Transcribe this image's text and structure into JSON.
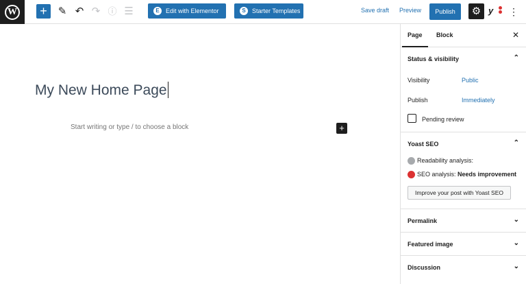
{
  "toolbar": {
    "logo_letter": "W",
    "add_label": "+",
    "edit_elementor": "Edit with Elementor",
    "elementor_icon": "E",
    "starter_templates": "Starter Templates",
    "starter_icon": "S",
    "save_draft": "Save draft",
    "preview": "Preview",
    "publish": "Publish",
    "yoast_glyph": "y"
  },
  "editor": {
    "title": "My New Home Page",
    "placeholder": "Start writing or type / to choose a block"
  },
  "sidebar": {
    "tabs": [
      "Page",
      "Block"
    ],
    "status": {
      "heading": "Status & visibility",
      "visibility_label": "Visibility",
      "visibility_value": "Public",
      "publish_label": "Publish",
      "publish_value": "Immediately",
      "pending_review": "Pending review"
    },
    "yoast": {
      "heading": "Yoast SEO",
      "readability": "Readability analysis:",
      "seo_prefix": "SEO analysis: ",
      "seo_status": "Needs improvement",
      "improve_button": "Improve your post with Yoast SEO",
      "readability_color": "#a7aaad",
      "seo_color": "#dc3232"
    },
    "panels": [
      "Permalink",
      "Featured image",
      "Discussion"
    ]
  },
  "colors": {
    "accent": "#2271b1",
    "dark": "#1e1e1e"
  },
  "icons": [
    "wordpress-logo-icon",
    "plus-icon",
    "pencil-icon",
    "undo-icon",
    "redo-icon",
    "info-icon",
    "list-view-icon",
    "gear-icon",
    "yoast-icon",
    "more-vertical-icon",
    "close-icon",
    "chevron-up-icon",
    "chevron-down-icon"
  ]
}
